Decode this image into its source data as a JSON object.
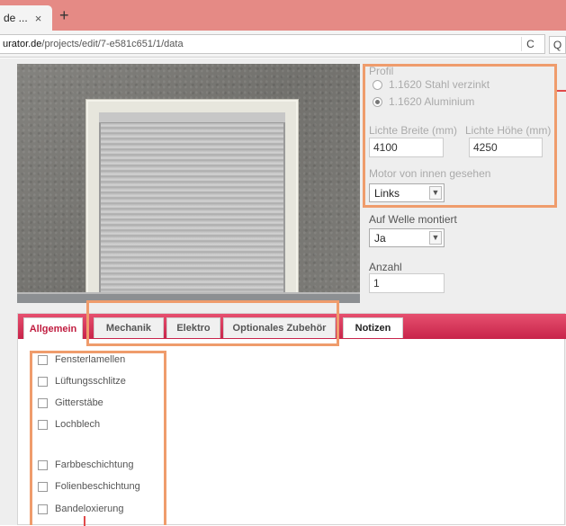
{
  "browser": {
    "tab_title": "de ...",
    "tab_close": "×",
    "new_tab": "+",
    "url_host": "urator.de",
    "url_path": "/projects/edit/7-e581c651/1/data",
    "reload": "C",
    "search": "Q"
  },
  "form": {
    "profil_label": "Profil",
    "profil_options": [
      {
        "label": "1.1620 Stahl verzinkt",
        "checked": false
      },
      {
        "label": "1.1620 Aluminium",
        "checked": true
      }
    ],
    "width_label": "Lichte Breite (mm)",
    "width_value": "4100",
    "height_label": "Lichte Höhe (mm)",
    "height_value": "4250",
    "motor_label": "Motor von innen gesehen",
    "motor_value": "Links",
    "welle_label": "Auf Welle montiert",
    "welle_value": "Ja",
    "anzahl_label": "Anzahl",
    "anzahl_value": "1"
  },
  "tabs": [
    "Allgemein",
    "Mechanik",
    "Elektro",
    "Optionales Zubehör",
    "Notizen"
  ],
  "checkboxes": [
    "Fensterlamellen",
    "Lüftungsschlitze",
    "Gitterstäbe",
    "Lochblech",
    "Farbbeschichtung",
    "Folienbeschichtung",
    "Bandeloxierung"
  ],
  "colors": {
    "tab_bar": "#e58a85",
    "tabs_strip": "#d8325a",
    "highlight": "#ef9c6c",
    "annotation_line": "#e04a4a"
  }
}
